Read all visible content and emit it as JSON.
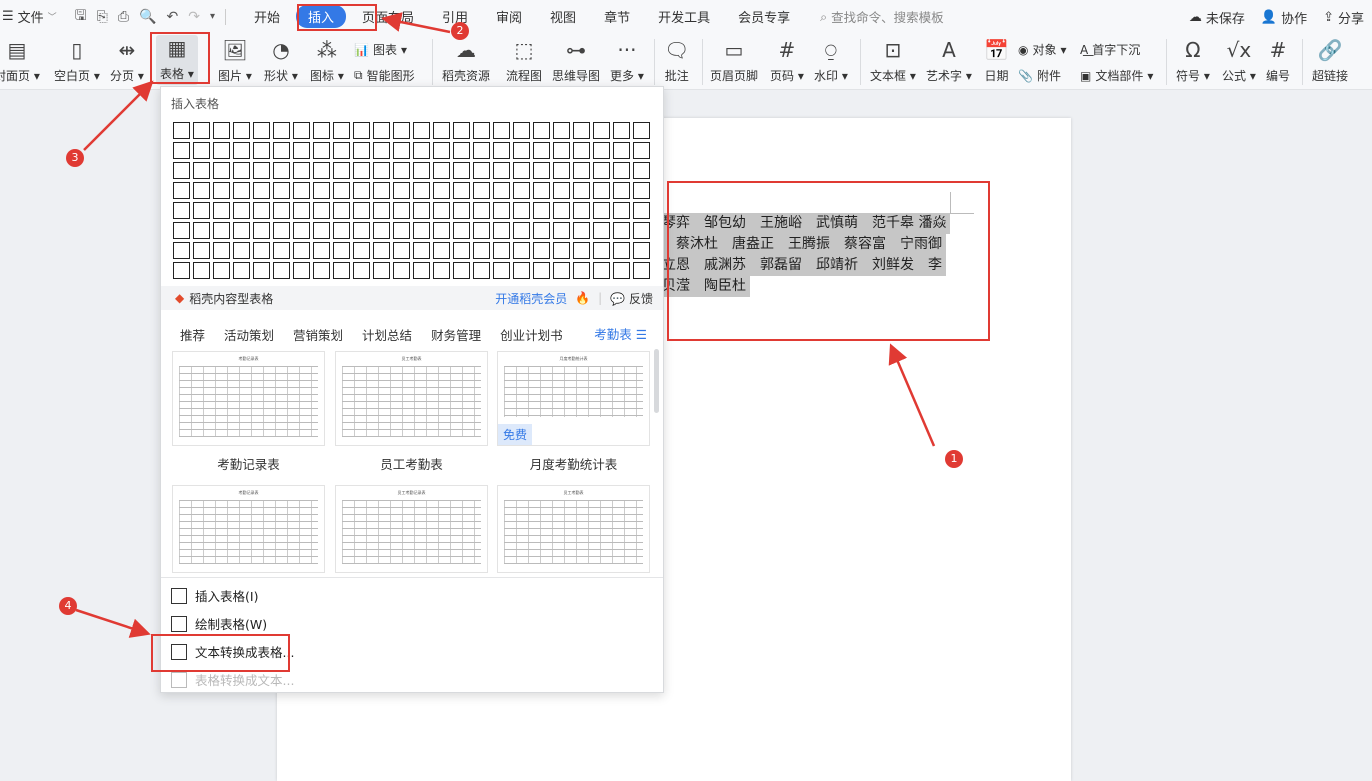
{
  "menubar": {
    "file_label": "文件",
    "tabs": [
      "开始",
      "插入",
      "页面布局",
      "引用",
      "审阅",
      "视图",
      "章节",
      "开发工具",
      "会员专享"
    ],
    "active_tab": "插入",
    "search_placeholder": "查找命令、搜索模板",
    "unsaved": "未保存",
    "collab": "协作",
    "share": "分享"
  },
  "ribbon": {
    "cover": "封面页",
    "blank": "空白页",
    "pagebreak": "分页",
    "table": "表格",
    "picture": "图片",
    "shape": "形状",
    "icon": "图标",
    "chart": "图表",
    "smart": "智能图形",
    "resource": "稻壳资源",
    "flow": "流程图",
    "mind": "思维导图",
    "more": "更多",
    "comment": "批注",
    "header": "页眉页脚",
    "pagenum": "页码",
    "watermark": "水印",
    "textbox": "文本框",
    "wordart": "艺术字",
    "date": "日期",
    "object": "对象",
    "dropcap": "首字下沉",
    "attachment": "附件",
    "docpart": "文档部件",
    "symbol": "符号",
    "formula": "公式",
    "numbering": "编号",
    "hyperlink": "超链接"
  },
  "document": {
    "lines": [
      "琴弈　邹包幼　王施峪　武慎萌　范千皋  潘焱",
      "　蔡沐杜　唐盎正　王腾振　蔡容富　宁雨御",
      "立恩　戚渊苏　郭磊留　邱靖祈　刘鲜发　李",
      "贝滢　陶臣杜"
    ]
  },
  "dropdown": {
    "title": "插入表格",
    "grid_cols": 24,
    "grid_rows": 8,
    "band_left": "稻壳内容型表格",
    "band_vip": "开通稻壳会员",
    "band_feedback": "反馈",
    "categories": [
      "推荐",
      "活动策划",
      "营销策划",
      "计划总结",
      "财务管理",
      "创业计划书"
    ],
    "category_more": "考勤表",
    "templates": [
      {
        "label": "考勤记录表",
        "title": "考勤记录表"
      },
      {
        "label": "员工考勤表",
        "title": "员工考勤表"
      },
      {
        "label": "月度考勤统计表",
        "title": "月度考勤统计表",
        "badge": "免费"
      },
      {
        "label": "",
        "title": "考勤记录表"
      },
      {
        "label": "",
        "title": "员工考勤记录表"
      },
      {
        "label": "",
        "title": "员工考勤表"
      }
    ],
    "menu": [
      "插入表格(I)",
      "绘制表格(W)",
      "文本转换成表格...",
      "表格转换成文本..."
    ]
  },
  "annotations": [
    "1",
    "2",
    "3",
    "4"
  ],
  "colors": {
    "accent": "#3479e6",
    "annotation": "#e03a33"
  }
}
